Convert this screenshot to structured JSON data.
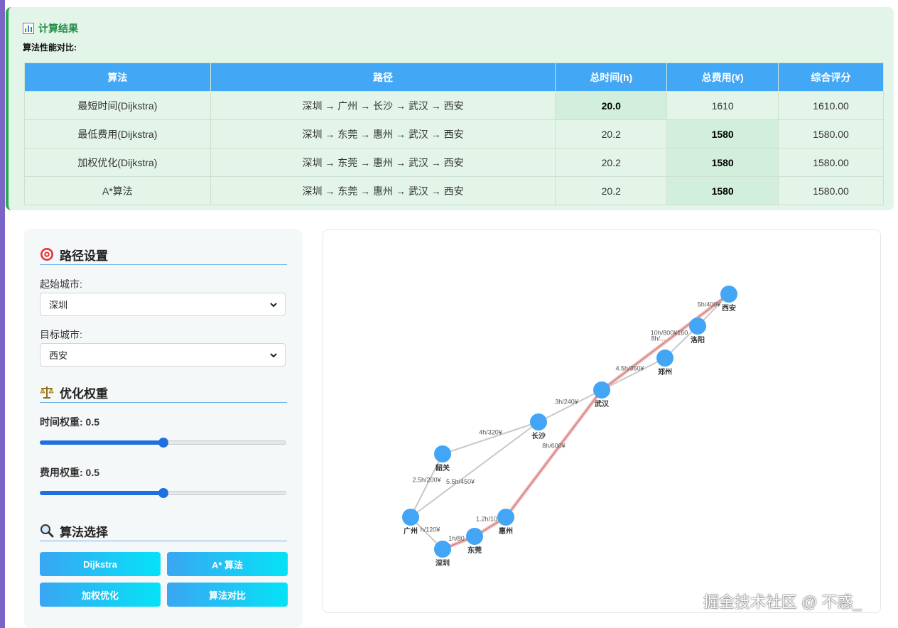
{
  "results": {
    "title": "计算结果",
    "subtitle": "算法性能对比:",
    "headers": [
      "算法",
      "路径",
      "总时间(h)",
      "总费用(¥)",
      "综合评分"
    ],
    "rows": [
      {
        "algo": "最短时间(Dijkstra)",
        "path": "深圳 → 广州 → 长沙 → 武汉 → 西安",
        "time": "20.0",
        "cost": "1610",
        "score": "1610.00"
      },
      {
        "algo": "最低费用(Dijkstra)",
        "path": "深圳 → 东莞 → 惠州 → 武汉 → 西安",
        "time": "20.2",
        "cost": "1580",
        "score": "1580.00"
      },
      {
        "algo": "加权优化(Dijkstra)",
        "path": "深圳 → 东莞 → 惠州 → 武汉 → 西安",
        "time": "20.2",
        "cost": "1580",
        "score": "1580.00"
      },
      {
        "algo": "A*算法",
        "path": "深圳 → 东莞 → 惠州 → 武汉 → 西安",
        "time": "20.2",
        "cost": "1580",
        "score": "1580.00"
      }
    ]
  },
  "settings": {
    "route_heading": "路径设置",
    "start_label": "起始城市:",
    "start_value": "深圳",
    "target_label": "目标城市:",
    "target_value": "西安",
    "weight_heading": "优化权重",
    "time_weight_label": "时间权重: 0.5",
    "time_weight": 0.5,
    "cost_weight_label": "费用权重: 0.5",
    "cost_weight": 0.5,
    "algo_heading": "算法选择",
    "buttons": {
      "dijkstra": "Dijkstra",
      "astar": "A* 算法",
      "weighted": "加权优化",
      "compare": "算法对比"
    }
  },
  "graph": {
    "nodes": [
      {
        "id": "xian",
        "name": "西安"
      },
      {
        "id": "luoyang",
        "name": "洛阳"
      },
      {
        "id": "zhengzhou",
        "name": "郑州"
      },
      {
        "id": "wuhan",
        "name": "武汉"
      },
      {
        "id": "changsha",
        "name": "长沙"
      },
      {
        "id": "shaoguan",
        "name": "韶关"
      },
      {
        "id": "guangzhou",
        "name": "广州"
      },
      {
        "id": "shenzhen",
        "name": "深圳"
      },
      {
        "id": "dongguan",
        "name": "东莞"
      },
      {
        "id": "huizhou",
        "name": "惠州"
      }
    ],
    "edges": [
      {
        "from": "wuhan",
        "to": "xian",
        "label": "8h/...",
        "highlight": true
      },
      {
        "from": "luoyang",
        "to": "xian",
        "label": "5h/400¥",
        "highlight": false
      },
      {
        "from": "zhengzhou",
        "to": "luoyang",
        "label": "10h/800¥160",
        "highlight": false
      },
      {
        "from": "wuhan",
        "to": "zhengzhou",
        "label": "4.5h/360¥",
        "highlight": false
      },
      {
        "from": "changsha",
        "to": "wuhan",
        "label": "3h/240¥",
        "highlight": false
      },
      {
        "from": "shaoguan",
        "to": "changsha",
        "label": "4h/320¥",
        "highlight": false
      },
      {
        "from": "guangzhou",
        "to": "changsha",
        "label": "5.5h/450¥",
        "highlight": false
      },
      {
        "from": "guangzhou",
        "to": "shaoguan",
        "label": "2.5h/200¥",
        "highlight": false
      },
      {
        "from": "shenzhen",
        "to": "guangzhou",
        "label": "h/120¥",
        "highlight": false
      },
      {
        "from": "shenzhen",
        "to": "dongguan",
        "label": "1h/80",
        "highlight": true
      },
      {
        "from": "dongguan",
        "to": "huizhou",
        "label": "1.2h/10",
        "highlight": true
      },
      {
        "from": "huizhou",
        "to": "wuhan",
        "label": "8h/600¥",
        "highlight": true
      }
    ],
    "colors": {
      "node": "#42a5f5",
      "edge": "#c8c8c8",
      "highlight": "#e08a8a"
    }
  },
  "watermark": "掘金技术社区 @ 不惑_"
}
